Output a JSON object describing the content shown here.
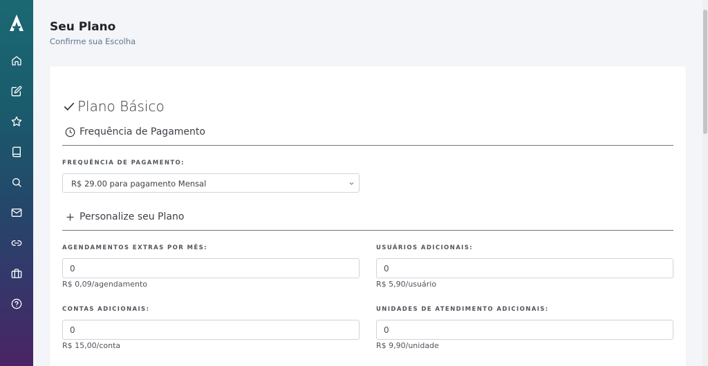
{
  "header": {
    "title": "Seu Plano",
    "subtitle": "Confirme sua Escolha"
  },
  "sidebar": {
    "items": [
      {
        "name": "home",
        "icon": "home-icon"
      },
      {
        "name": "edit",
        "icon": "edit-icon"
      },
      {
        "name": "favorites",
        "icon": "star-icon"
      },
      {
        "name": "book",
        "icon": "book-icon"
      },
      {
        "name": "search",
        "icon": "search-icon"
      },
      {
        "name": "mail",
        "icon": "mail-icon"
      },
      {
        "name": "link",
        "icon": "link-icon"
      },
      {
        "name": "briefcase",
        "icon": "briefcase-icon"
      },
      {
        "name": "help",
        "icon": "help-icon"
      }
    ]
  },
  "plan": {
    "title": "Plano Básico"
  },
  "frequency": {
    "section_title": "Frequência de Pagamento",
    "field_label": "FREQUÊNCIA DE PAGAMENTO:",
    "selected": "R$ 29.00 para pagamento Mensal"
  },
  "customize": {
    "section_title": "Personalize seu Plano",
    "fields": [
      {
        "label": "AGENDAMENTOS EXTRAS POR MÊS:",
        "value": "0",
        "hint": "R$ 0,09/agendamento"
      },
      {
        "label": "USUÁRIOS ADICIONAIS:",
        "value": "0",
        "hint": "R$ 5,90/usuário"
      },
      {
        "label": "CONTAS ADICIONAIS:",
        "value": "0",
        "hint": "R$ 15,00/conta"
      },
      {
        "label": "UNIDADES DE ATENDIMENTO ADICIONAIS:",
        "value": "0",
        "hint": "R$ 9,90/unidade"
      }
    ]
  },
  "colors": {
    "sidebar_top": "#1b6873",
    "sidebar_bottom": "#4a2466",
    "subtitle": "#5d7690"
  }
}
